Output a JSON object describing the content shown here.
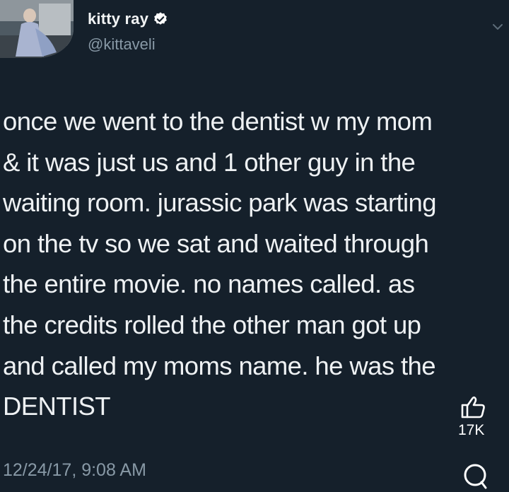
{
  "user": {
    "display_name": "kitty ray",
    "handle": "@kittaveli",
    "verified_icon": "verified-badge-icon"
  },
  "tweet": {
    "lines": [
      "once we went to the dentist w my mom",
      "& it was just us and 1 other guy in the",
      "waiting room. jurassic park was starting",
      "on the tv so we sat and waited through",
      "the entire movie. no names called. as",
      "the credits rolled the other man got up",
      "and called my moms name. he was the",
      "DENTIST"
    ],
    "timestamp": "12/24/17, 9:08 AM"
  },
  "actions": {
    "like_icon": "thumbs-up-icon",
    "like_count": "17K",
    "reply_icon": "comment-icon",
    "menu_icon": "chevron-down-icon"
  },
  "colors": {
    "background": "#15202b",
    "text": "#eef1f3",
    "muted": "#8899a6"
  }
}
